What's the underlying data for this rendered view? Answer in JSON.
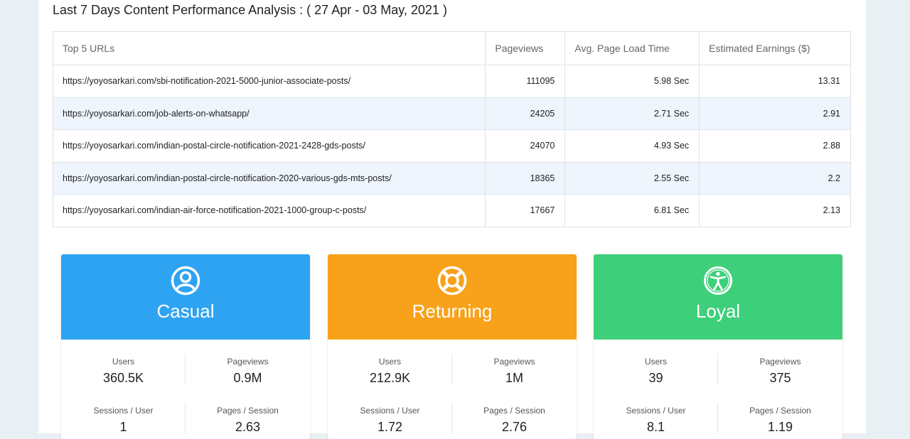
{
  "heading": "Last 7 Days Content Performance Analysis : ( 27 Apr - 03 May, 2021 )",
  "table": {
    "headers": [
      "Top 5 URLs",
      "Pageviews",
      "Avg. Page Load Time",
      "Estimated Earnings ($)"
    ],
    "rows": [
      [
        "https://yoyosarkari.com/sbi-notification-2021-5000-junior-associate-posts/",
        "111095",
        "5.98 Sec",
        "13.31"
      ],
      [
        "https://yoyosarkari.com/job-alerts-on-whatsapp/",
        "24205",
        "2.71 Sec",
        "2.91"
      ],
      [
        "https://yoyosarkari.com/indian-postal-circle-notification-2021-2428-gds-posts/",
        "24070",
        "4.93 Sec",
        "2.88"
      ],
      [
        "https://yoyosarkari.com/indian-postal-circle-notification-2020-various-gds-mts-posts/",
        "18365",
        "2.55 Sec",
        "2.2"
      ],
      [
        "https://yoyosarkari.com/indian-air-force-notification-2021-1000-group-c-posts/",
        "17667",
        "6.81 Sec",
        "2.13"
      ]
    ]
  },
  "cards": [
    {
      "title": "Casual",
      "color": "#2ea3f2",
      "icon": "user-circle-icon",
      "users_label": "Users",
      "users": "360.5K",
      "pageviews_label": "Pageviews",
      "pageviews": "0.9M",
      "sessions_user_label": "Sessions / User",
      "sessions_user": "1",
      "pages_session_label": "Pages / Session",
      "pages_session": "2.63"
    },
    {
      "title": "Returning",
      "color": "#f8a11a",
      "icon": "life-ring-icon",
      "users_label": "Users",
      "users": "212.9K",
      "pageviews_label": "Pageviews",
      "pageviews": "1M",
      "sessions_user_label": "Sessions / User",
      "sessions_user": "1.72",
      "pages_session_label": "Pages / Session",
      "pages_session": "2.76"
    },
    {
      "title": "Loyal",
      "color": "#3ecf7a",
      "icon": "accessibility-icon",
      "users_label": "Users",
      "users": "39",
      "pageviews_label": "Pageviews",
      "pageviews": "375",
      "sessions_user_label": "Sessions / User",
      "sessions_user": "8.1",
      "pages_session_label": "Pages / Session",
      "pages_session": "1.19"
    }
  ]
}
